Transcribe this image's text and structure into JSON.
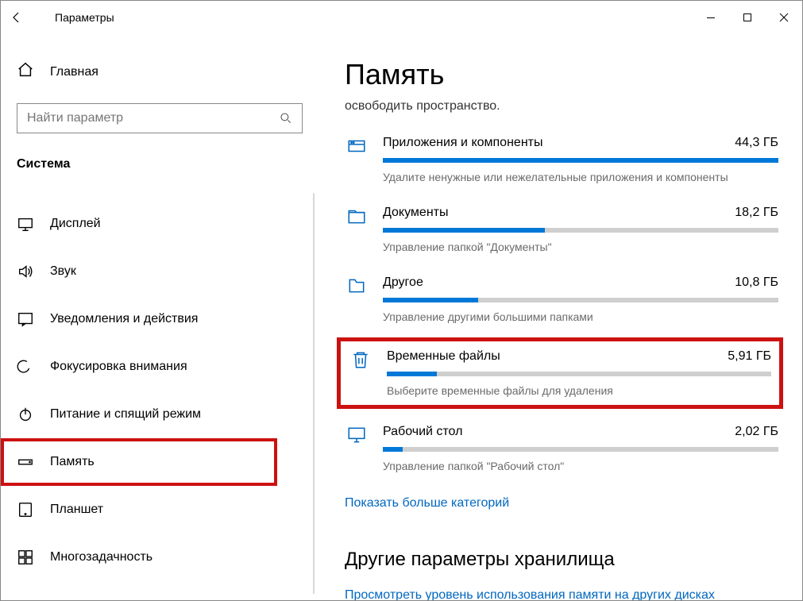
{
  "window": {
    "title": "Параметры"
  },
  "sidebar": {
    "home_label": "Главная",
    "search_placeholder": "Найти параметр",
    "category": "Система",
    "items": [
      {
        "label": "Дисплей"
      },
      {
        "label": "Звук"
      },
      {
        "label": "Уведомления и действия"
      },
      {
        "label": "Фокусировка внимания"
      },
      {
        "label": "Питание и спящий режим"
      },
      {
        "label": "Память"
      },
      {
        "label": "Планшет"
      },
      {
        "label": "Многозадачность"
      }
    ]
  },
  "main": {
    "title": "Память",
    "subtext": "освободить пространство.",
    "rows": [
      {
        "title": "Приложения и компоненты",
        "size": "44,3 ГБ",
        "percent": 100,
        "desc": "Удалите ненужные или нежелательные приложения и компоненты"
      },
      {
        "title": "Документы",
        "size": "18,2 ГБ",
        "percent": 41,
        "desc": "Управление папкой \"Документы\""
      },
      {
        "title": "Другое",
        "size": "10,8 ГБ",
        "percent": 24,
        "desc": "Управление другими большими папками"
      },
      {
        "title": "Временные файлы",
        "size": "5,91 ГБ",
        "percent": 13,
        "desc": "Выберите временные файлы для удаления"
      },
      {
        "title": "Рабочий стол",
        "size": "2,02 ГБ",
        "percent": 5,
        "desc": "Управление папкой \"Рабочий стол\""
      }
    ],
    "show_more": "Показать больше категорий",
    "other_heading": "Другие параметры хранилища",
    "other_link": "Просмотреть уровень использования памяти на других дисках"
  }
}
